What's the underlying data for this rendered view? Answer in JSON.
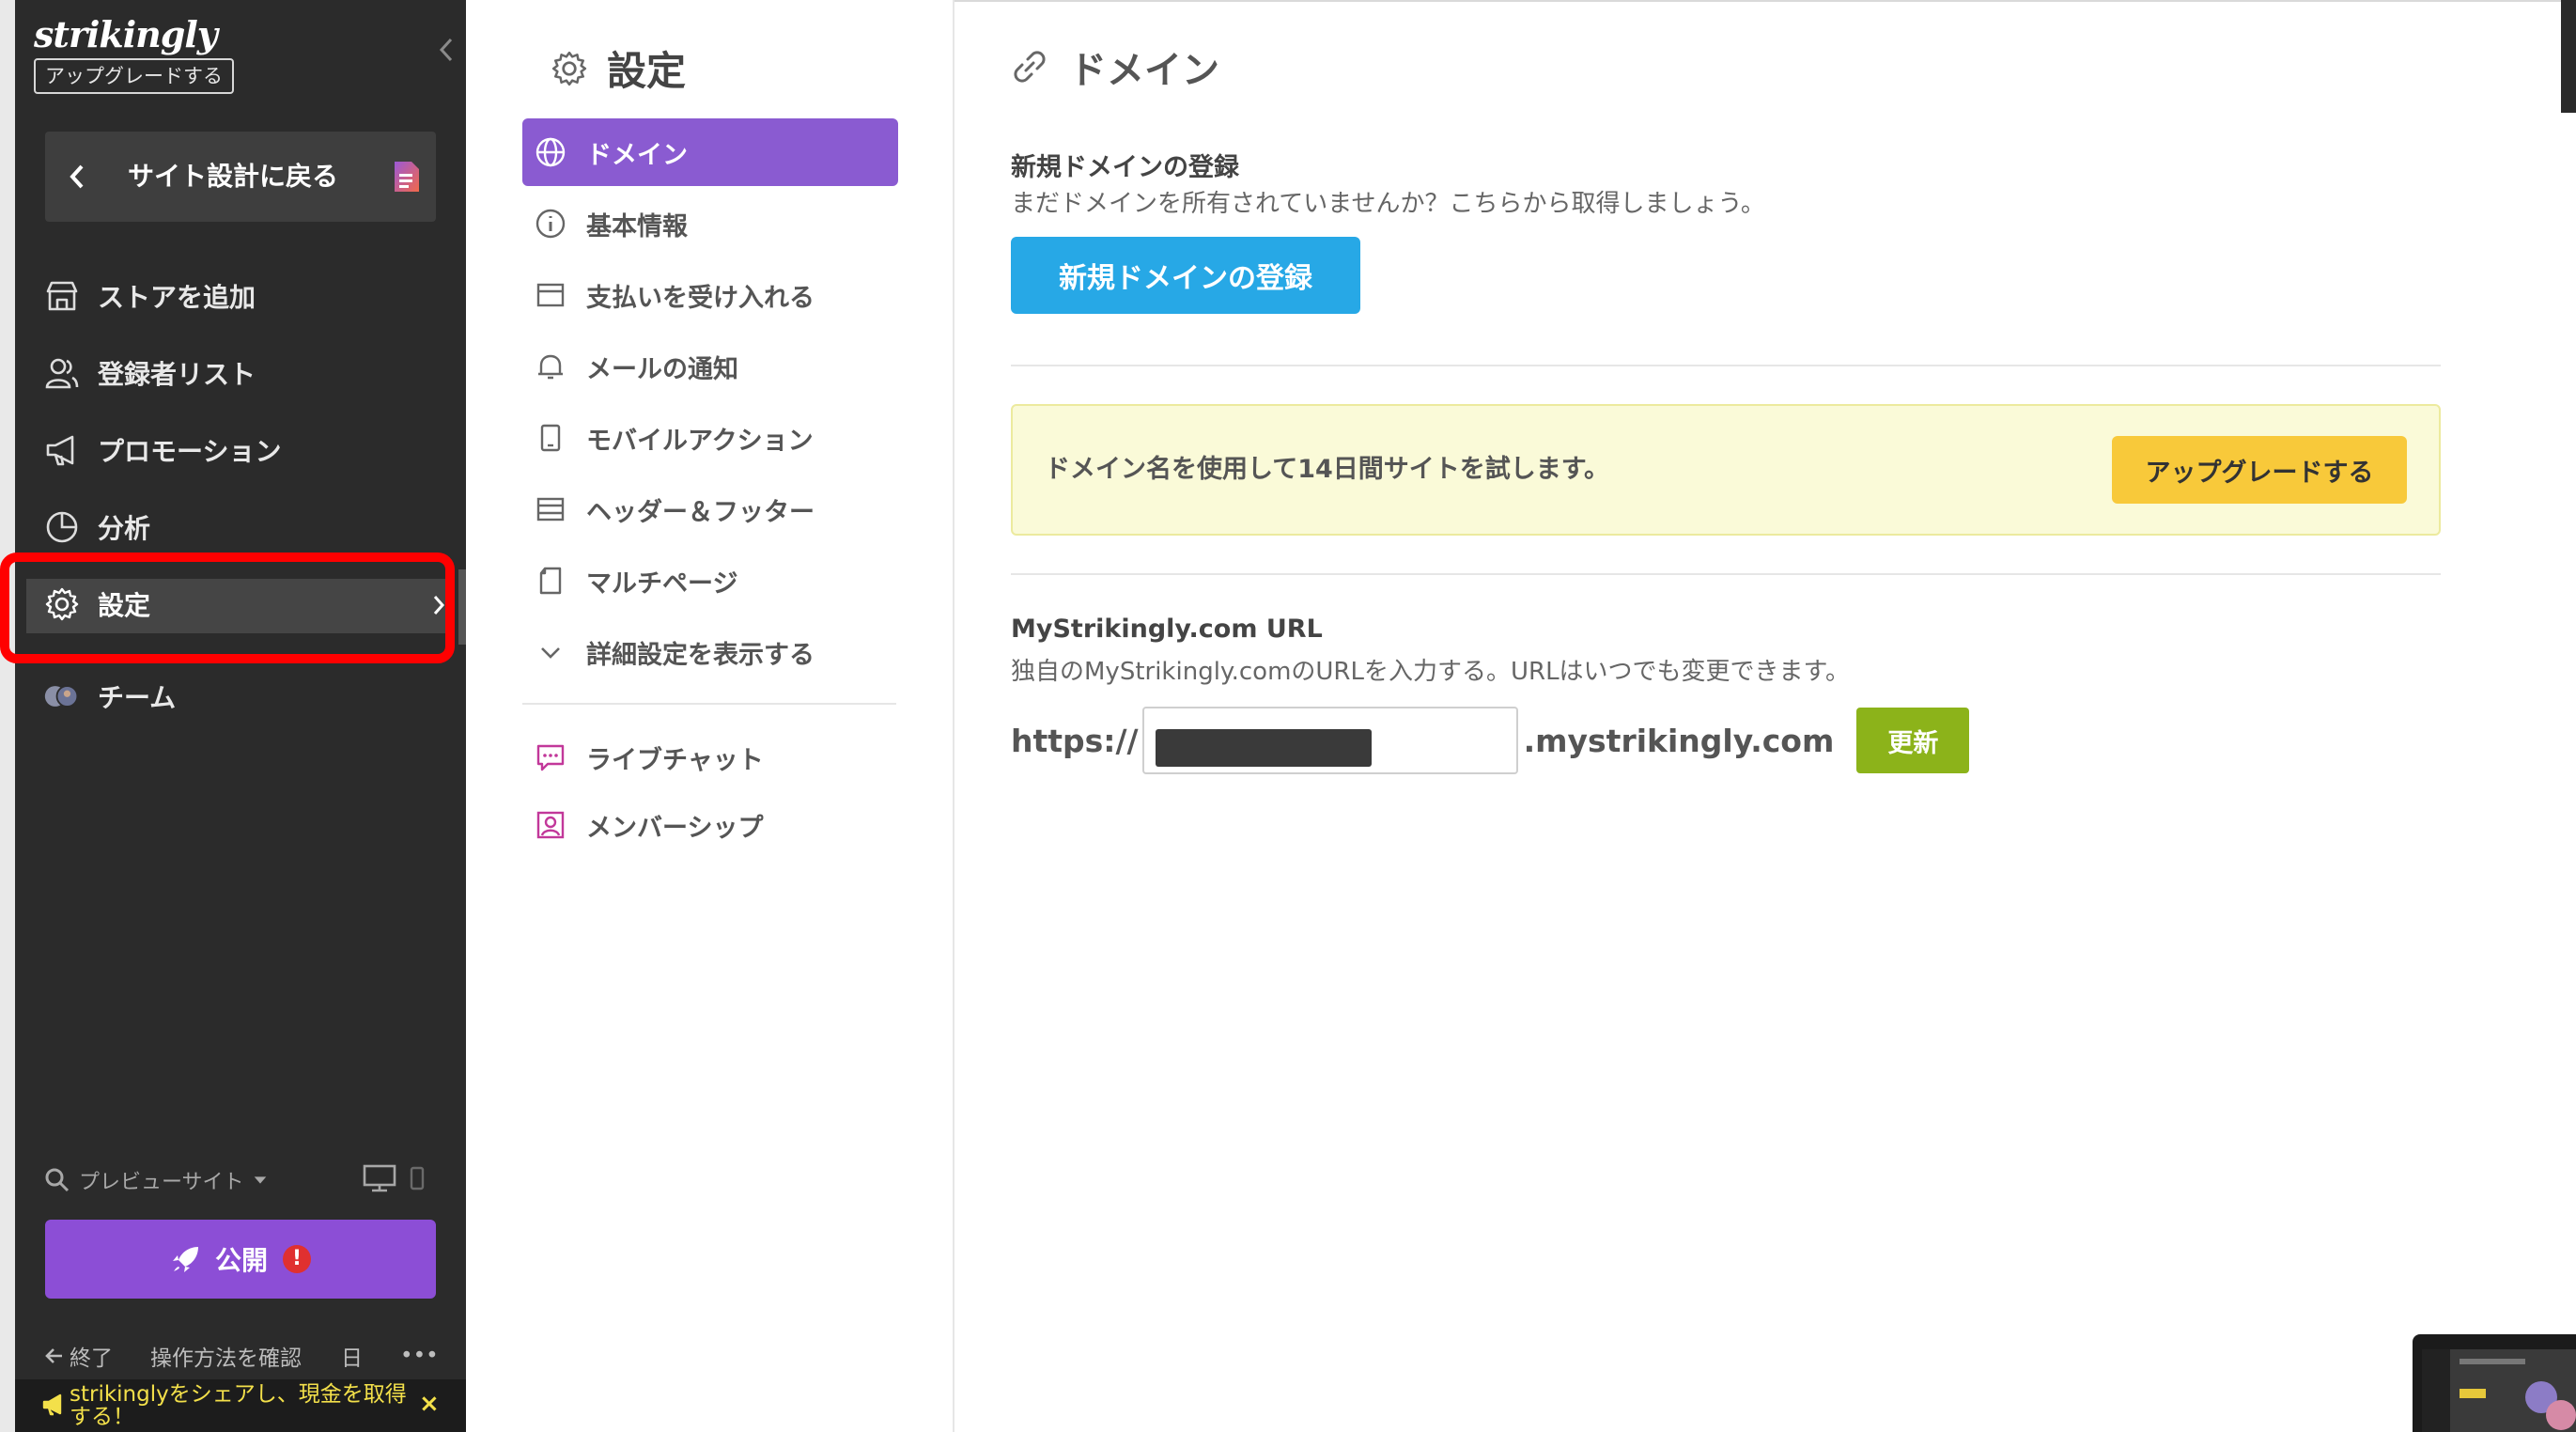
{
  "sidebar": {
    "logo": "strikingly",
    "upgrade_badge": "アップグレードする",
    "back_label": "サイト設計に戻る",
    "items": [
      {
        "label": "ストアを追加",
        "icon": "store-icon"
      },
      {
        "label": "登録者リスト",
        "icon": "users-icon"
      },
      {
        "label": "プロモーション",
        "icon": "megaphone-icon"
      },
      {
        "label": "分析",
        "icon": "pie-chart-icon"
      },
      {
        "label": "設定",
        "icon": "gear-icon",
        "active": true
      },
      {
        "label": "チーム",
        "icon": "team-avatars-icon"
      }
    ],
    "preview_label": "プレビューサイト",
    "publish_label": "公開",
    "publish_alert": "!",
    "footer": {
      "exit_label": "終了",
      "howto_label": "操作方法を確認",
      "lang_label": "日",
      "more_label": "•••"
    },
    "share_text": "strikinglyをシェアし、現金を取得する！",
    "share_close": "×"
  },
  "settings_menu": {
    "title": "設定",
    "items": [
      {
        "label": "ドメイン",
        "icon": "globe-icon",
        "active": true
      },
      {
        "label": "基本情報",
        "icon": "info-icon"
      },
      {
        "label": "支払いを受け入れる",
        "icon": "payment-icon"
      },
      {
        "label": "メールの通知",
        "icon": "bell-icon"
      },
      {
        "label": "モバイルアクション",
        "icon": "mobile-icon"
      },
      {
        "label": "ヘッダー＆フッター",
        "icon": "header-footer-icon"
      },
      {
        "label": "マルチページ",
        "icon": "pages-icon"
      },
      {
        "label": "詳細設定を表示する",
        "icon": "chevron-down-icon"
      }
    ],
    "extras": [
      {
        "label": "ライブチャット",
        "icon": "chat-icon"
      },
      {
        "label": "メンバーシップ",
        "icon": "membership-icon"
      }
    ]
  },
  "main": {
    "title": "ドメイン",
    "new_domain": {
      "heading": "新規ドメインの登録",
      "desc": "まだドメインを所有されていませんか？こちらから取得しましょう。",
      "button": "新規ドメインの登録"
    },
    "trial": {
      "message": "ドメイン名を使用して14日間サイトを試します。",
      "button": "アップグレードする"
    },
    "url_section": {
      "heading": "MyStrikingly.com URL",
      "desc": "独自のMyStrikingly.comのURLを入力する。URLはいつでも変更できます。",
      "prefix": "https://",
      "suffix": ".mystrikingly.com",
      "button": "更新"
    }
  },
  "colors": {
    "sidebar_bg": "#2b2b2b",
    "accent_purple": "#8a5bd1",
    "blue_button": "#27a8e6",
    "yellow_button": "#f8c93a",
    "green_button": "#8cb31a",
    "highlight_red": "#ff0000"
  }
}
